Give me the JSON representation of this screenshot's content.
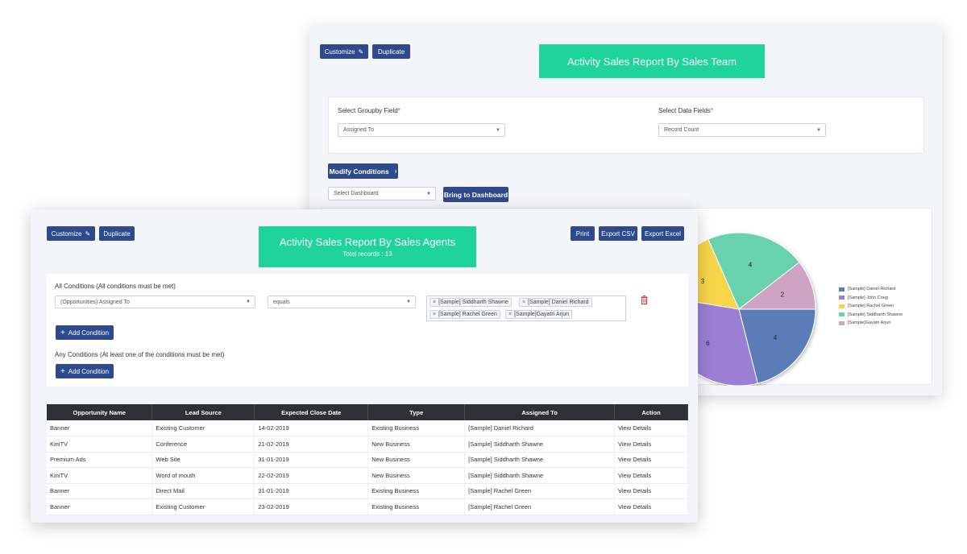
{
  "back_panel": {
    "customize_label": "Customize",
    "duplicate_label": "Duplicate",
    "title": "Activity Sales Report By Sales Team",
    "groupby_label": "Select Groupby Field",
    "groupby_value": "Assigned To",
    "datafields_label": "Select Data Fields",
    "datafields_value": "Record Count",
    "required_mark": "*",
    "modify_conditions_label": "Modify Conditions",
    "dashboard_select": "Select Dashboard",
    "bring_dashboard_label": "Bring to Dashboard"
  },
  "front_panel": {
    "customize_label": "Customize",
    "duplicate_label": "Duplicate",
    "title": "Activity Sales Report By Sales Agents",
    "subtitle": "Total records : 13",
    "print_label": "Print",
    "export_csv_label": "Export CSV",
    "export_excel_label": "Export Excel",
    "all_conditions_title": "All Conditions",
    "all_conditions_hint": "(All conditions must be met)",
    "condition_field": "(Opportunities) Assigned To",
    "condition_operator": "equals",
    "condition_values": [
      "[Sample] Siddharth Shawne",
      "[Sample] Daniel Richard",
      "[Sample] Rachel Green",
      "[Sample]Gayatri Arjun"
    ],
    "add_condition_label": "Add Condition",
    "any_conditions_title": "Any Conditions",
    "any_conditions_hint": "(At least one of the conditions must be met)"
  },
  "table": {
    "headers": [
      "Opportunity Name",
      "Lead Source",
      "Expected Close Date",
      "Type",
      "Assigned To",
      "Action"
    ],
    "rows": [
      [
        "Banner",
        "Existing Customer",
        "14-02-2019",
        "Existing Business",
        "[Sample] Daniel Richard",
        "View Details"
      ],
      [
        "KiniTV",
        "Conference",
        "21-02-2019",
        "New Business",
        "[Sample] Siddharth Shawne",
        "View Details"
      ],
      [
        "Premium Ads",
        "Web Site",
        "31-01-2019",
        "New Business",
        "[Sample] Siddharth Shawne",
        "View Details"
      ],
      [
        "KiniTV",
        "Word of mouth",
        "22-02-2019",
        "New Business",
        "[Sample] Siddharth Shawne",
        "View Details"
      ],
      [
        "Banner",
        "Direct Mail",
        "31-01-2019",
        "Existing Business",
        "[Sample] Rachel Green",
        "View Details"
      ],
      [
        "Banner",
        "Existing Customer",
        "23-02-2019",
        "Existing Business",
        "[Sample] Rachel Green",
        "View Details"
      ]
    ]
  },
  "chart_data": {
    "type": "pie",
    "categories": [
      "[Sample] Daniel Richard",
      "[Sample] John Craig",
      "[Sample] Rachel Green",
      "[Sample] Siddharth Shawne",
      "[Sample]Gayatri Arjun"
    ],
    "values": [
      4,
      6,
      3,
      4,
      2
    ],
    "colors": [
      "#5b7bb8",
      "#9b7fd4",
      "#f7d54a",
      "#67d1ad",
      "#cfa3c4"
    ],
    "legend": "right"
  },
  "colors": {
    "primary_button": "#2e4a8c",
    "title_accent": "#1ed49a",
    "table_header": "#2f3033",
    "delete_icon": "#d9332b"
  }
}
